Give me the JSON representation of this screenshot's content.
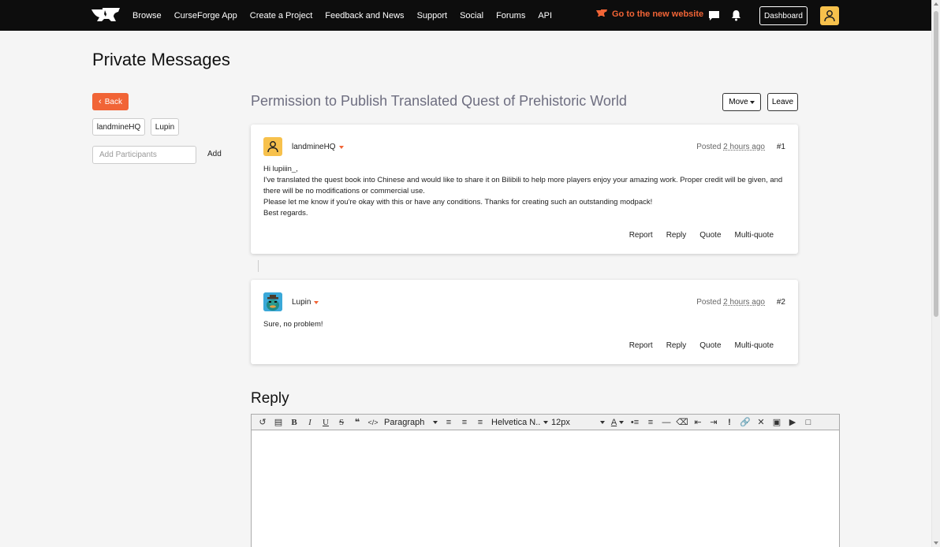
{
  "nav": {
    "links": [
      "Browse",
      "CurseForge App",
      "Create a Project",
      "Feedback and News",
      "Support",
      "Social",
      "Forums",
      "API"
    ],
    "new_site": "Go to the new website",
    "dashboard": "Dashboard"
  },
  "page_title": "Private Messages",
  "sidebar": {
    "back": "Back",
    "participants": [
      "landmineHQ",
      "Lupin"
    ],
    "add_placeholder": "Add Participants",
    "add_label": "Add"
  },
  "thread": {
    "title": "Permission to Publish Translated Quest of Prehistoric World",
    "move": "Move",
    "leave": "Leave"
  },
  "posts": [
    {
      "author": "landmineHQ",
      "posted_label": "Posted",
      "ago": "2 hours ago",
      "num": "#1",
      "body": [
        "Hi lupiiin_,",
        "I've translated the quest book into Chinese and would like to share it on Bilibili to help more players enjoy your amazing work. Proper credit will be given, and there will be no modifications or commercial use.",
        "Please let me know if you're okay with this or have any conditions. Thanks for creating such an outstanding modpack!",
        "Best regards."
      ],
      "actions": [
        "Report",
        "Reply",
        "Quote",
        "Multi-quote"
      ]
    },
    {
      "author": "Lupin",
      "posted_label": "Posted",
      "ago": "2 hours ago",
      "num": "#2",
      "body": [
        "Sure, no problem!"
      ],
      "actions": [
        "Report",
        "Reply",
        "Quote",
        "Multi-quote"
      ]
    }
  ],
  "reply": {
    "title": "Reply",
    "toolbar": {
      "format": "Paragraph",
      "font": "Helvetica N..",
      "size": "12px"
    }
  },
  "colors": {
    "accent": "#f16436",
    "avatar_yellow": "#f7c14c",
    "nav_bg": "#0d0d0d"
  }
}
